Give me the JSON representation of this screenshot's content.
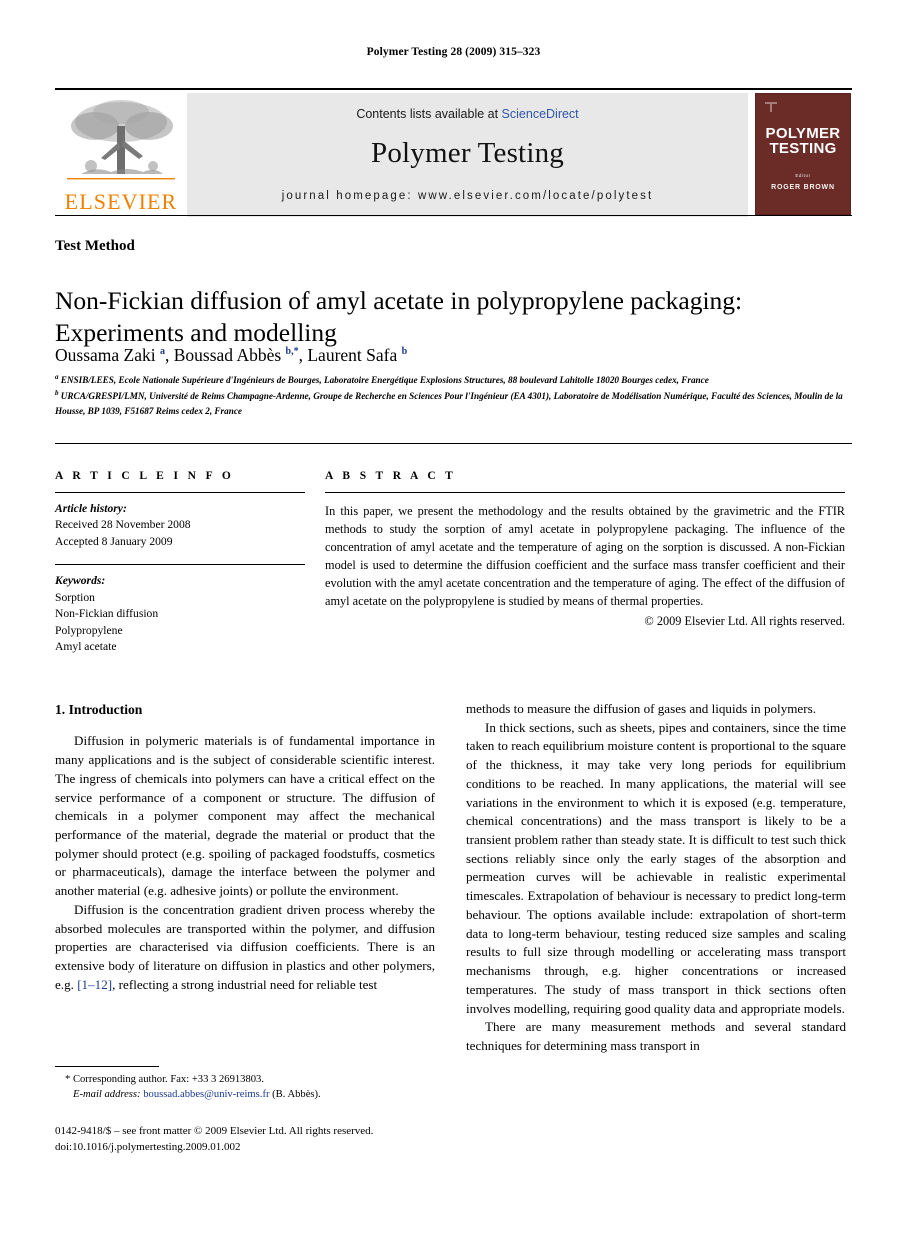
{
  "running_head": "Polymer Testing 28 (2009) 315–323",
  "masthead": {
    "publisher_logo_label": "ELSEVIER",
    "contents_prefix": "Contents lists available at ",
    "contents_link": "ScienceDirect",
    "journal_title": "Polymer Testing",
    "homepage": "journal homepage: www.elsevier.com/locate/polytest",
    "cover": {
      "line1": "POLYMER",
      "line2": "TESTING",
      "editor_label": "Editor",
      "editor_name": "ROGER BROWN"
    }
  },
  "article": {
    "section_label": "Test Method",
    "title": "Non-Fickian diffusion of amyl acetate in polypropylene packaging: Experiments and modelling",
    "authors_html": "Oussama Zaki <sup>a</sup>, Boussad Abbès <sup>b,*</sup>, Laurent Safa <sup>b</sup>",
    "affiliation_a": "ENSIB/LEES, Ecole Nationale Supérieure d'Ingénieurs de Bourges, Laboratoire Energétique Explosions Structures, 88 boulevard Lahitolle 18020 Bourges cedex, France",
    "affiliation_b": "URCA/GRESPI/LMN, Université de Reims Champagne-Ardenne, Groupe de Recherche en Sciences Pour l'Ingénieur (EA 4301), Laboratoire de Modélisation Numérique, Faculté des Sciences, Moulin de la Housse, BP 1039, F51687 Reims cedex 2, France"
  },
  "article_info": {
    "heading": "A R T I C L E    I N F O",
    "history_label": "Article history:",
    "received": "Received 28 November 2008",
    "accepted": "Accepted 8 January 2009",
    "keywords_label": "Keywords:",
    "keywords": [
      "Sorption",
      "Non-Fickian diffusion",
      "Polypropylene",
      "Amyl acetate"
    ]
  },
  "abstract": {
    "heading": "A B S T R A C T",
    "text": "In this paper, we present the methodology and the results obtained by the gravimetric and the FTIR methods to study the sorption of amyl acetate in polypropylene packaging. The influence of the concentration of amyl acetate and the temperature of aging on the sorption is discussed. A non-Fickian model is used to determine the diffusion coefficient and the surface mass transfer coefficient and their evolution with the amyl acetate concentration and the temperature of aging. The effect of the diffusion of amyl acetate on the polypropylene is studied by means of thermal properties.",
    "copyright": "© 2009 Elsevier Ltd. All rights reserved."
  },
  "body": {
    "section_number_title": "1. Introduction",
    "left_paragraphs": [
      "Diffusion in polymeric materials is of fundamental importance in many applications and is the subject of considerable scientific interest. The ingress of chemicals into polymers can have a critical effect on the service performance of a component or structure. The diffusion of chemicals in a polymer component may affect the mechanical performance of the material, degrade the material or product that the polymer should protect (e.g. spoiling of packaged foodstuffs, cosmetics or pharmaceuticals), damage the interface between the polymer and another material (e.g. adhesive joints) or pollute the environment."
    ],
    "left_paragraph_2_part1": "Diffusion is the concentration gradient driven process whereby the absorbed molecules are transported within the polymer, and diffusion properties are characterised via diffusion coefficients. There is an extensive body of literature on diffusion in plastics and other polymers, e.g. ",
    "left_citation": "[1–12]",
    "left_paragraph_2_part2": ", reflecting a strong industrial need for reliable test",
    "right_paragraphs": [
      "methods to measure the diffusion of gases and liquids in polymers.",
      "In thick sections, such as sheets, pipes and containers, since the time taken to reach equilibrium moisture content is proportional to the square of the thickness, it may take very long periods for equilibrium conditions to be reached. In many applications, the material will see variations in the environment to which it is exposed (e.g. temperature, chemical concentrations) and the mass transport is likely to be a transient problem rather than steady state. It is difficult to test such thick sections reliably since only the early stages of the absorption and permeation curves will be achievable in realistic experimental timescales. Extrapolation of behaviour is necessary to predict long-term behaviour. The options available include: extrapolation of short-term data to long-term behaviour, testing reduced size samples and scaling results to full size through modelling or accelerating mass transport mechanisms through, e.g. higher concentrations or increased temperatures. The study of mass transport in thick sections often involves modelling, requiring good quality data and appropriate models.",
      "There are many measurement methods and several standard techniques for determining mass transport in"
    ]
  },
  "footnotes": {
    "corresponding": "* Corresponding author. Fax: +33 3 26913803.",
    "email_label": "E-mail address:",
    "email": "boussad.abbes@univ-reims.fr",
    "email_suffix": " (B. Abbès).",
    "issn_line": "0142-9418/$ – see front matter © 2009 Elsevier Ltd. All rights reserved.",
    "doi_line": "doi:10.1016/j.polymertesting.2009.01.002"
  },
  "colors": {
    "link_blue": "#1a3a8f",
    "sciencedirect_blue": "#2d56a8",
    "elsevier_orange": "#f08100",
    "cover_maroon": "#6b2b26",
    "banner_grey": "#e8e8e8"
  }
}
